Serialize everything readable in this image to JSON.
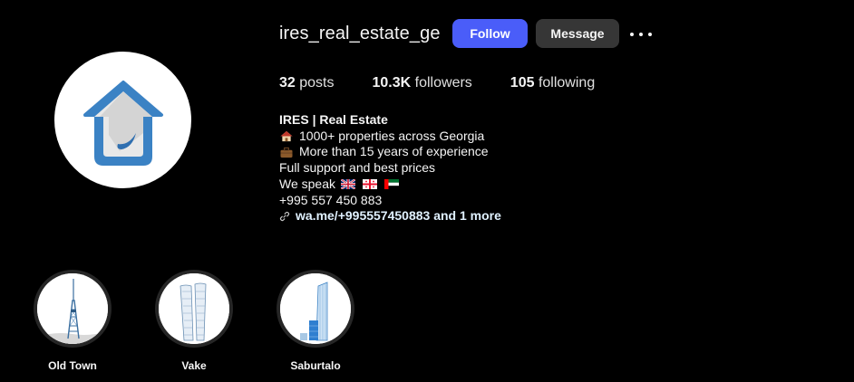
{
  "profile": {
    "username": "ires_real_estate_ge",
    "follow_label": "Follow",
    "message_label": "Message"
  },
  "stats": {
    "posts_count": "32",
    "posts_label": "posts",
    "followers_count": "10.3K",
    "followers_label": "followers",
    "following_count": "105",
    "following_label": "following"
  },
  "bio": {
    "name": "IRES | Real Estate",
    "line1": "1000+ properties across Georgia",
    "line2": "More than 15 years of experience",
    "line3": "Full support and best prices",
    "line4": "We speak",
    "phone": "+995 557 450 883",
    "link": "wa.me/+995557450883 and 1 more",
    "flags": [
      "uk-flag",
      "georgia-flag",
      "uae-flag"
    ]
  },
  "highlights": [
    {
      "label": "Old Town",
      "icon": "tv-tower"
    },
    {
      "label": "Vake",
      "icon": "twin-towers"
    },
    {
      "label": "Saburtalo",
      "icon": "glass-tower"
    }
  ],
  "colors": {
    "background": "#000000",
    "follow_button": "#4a5df9",
    "message_button": "#363636",
    "logo_blue": "#3b82c4"
  }
}
